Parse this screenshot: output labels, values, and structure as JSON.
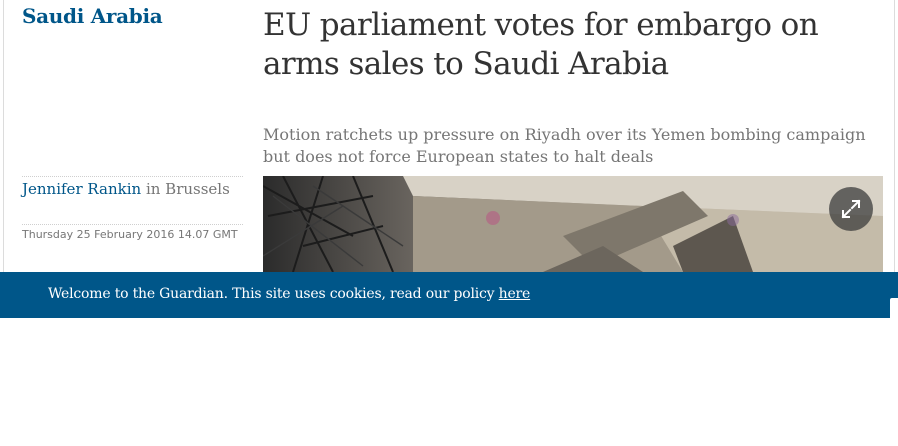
{
  "section": {
    "label": "Saudi Arabia"
  },
  "article": {
    "headline": "EU parliament votes for embargo on arms sales to Saudi Arabia",
    "standfirst": "Motion ratchets up pressure on Riyadh over its Yemen bombing campaign but does not force European states to halt deals",
    "author": "Jennifer Rankin",
    "location_prefix": " in ",
    "location": "Brussels",
    "date": "Thursday 25 February 2016 14.07 GMT"
  },
  "media": {
    "expand_icon": "expand-icon"
  },
  "cookie_banner": {
    "text": "Welcome to the Guardian. This site uses cookies, read our policy ",
    "link_label": "here"
  },
  "colors": {
    "brand_blue": "#005689",
    "headline": "#333333",
    "muted": "#767676"
  }
}
